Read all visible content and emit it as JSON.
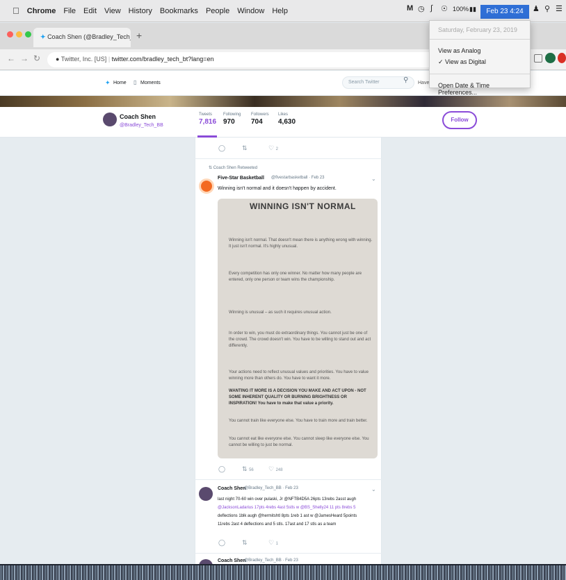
{
  "menubar": {
    "items": [
      "Chrome",
      "File",
      "Edit",
      "View",
      "History",
      "Bookmarks",
      "People",
      "Window",
      "Help"
    ],
    "battery": "100%",
    "clock": "Feb 23  4:24 PM"
  },
  "clock_menu": {
    "date": "Saturday, February 23, 2019",
    "view_analog": "View as Analog",
    "view_digital": "✓ View as Digital",
    "preferences": "Open Date & Time Preferences..."
  },
  "browser": {
    "tab_title": "Coach Shen (@Bradley_Tech_) ×",
    "address_prefix": "Twitter, Inc. [US]",
    "url": "twitter.com/bradley_tech_bt?lang=en"
  },
  "twitter_nav": {
    "home": "Home",
    "moments": "Moments",
    "search_placeholder": "Search Twitter",
    "have_account": "Have"
  },
  "profile": {
    "name": "Coach Shen",
    "handle": "@Bradley_Tech_BB",
    "stats": [
      {
        "label": "Tweets",
        "value": "7,816"
      },
      {
        "label": "Following",
        "value": "970"
      },
      {
        "label": "Followers",
        "value": "704"
      },
      {
        "label": "Likes",
        "value": "4,630"
      }
    ],
    "follow_label": "Follow"
  },
  "tweets": {
    "top_actions": {
      "replies": "",
      "retweets": "",
      "likes": "2"
    },
    "retweet_note": "Coach Shen Retweeted",
    "rt_author": "Five-Star Basketball",
    "rt_handle_date": "@fivestarbasketball · Feb 23",
    "rt_text": "Winning isn't normal and it doesn't happen by accident.",
    "rt_actions": {
      "replies": "",
      "retweets": "56",
      "likes": "248"
    },
    "photo": {
      "title": "WINNING ISN'T NORMAL",
      "p1": "Winning isn't normal. That doesn't mean there is anything wrong with winning. It just isn't normal. It's highly unusual.",
      "p2": "Every competition has only one winner. No matter how many people are entered, only one person or team wins the championship.",
      "p3": "Winning is unusual – as such it requires unusual action.",
      "p4": "In order to win, you must do extraordinary things. You cannot just be one of the crowd. The crowd doesn't win. You have to be willing to stand out and act differently.",
      "p5": "Your actions need to reflect unusual values and priorities. You have to value winning more than others do. You have to want it more.",
      "p6": "WANTING IT MORE IS A DECISION YOU MAKE AND ACT UPON - NOT SOME INHERENT QUALITY OR BURNING BRIGHTNESS OR INSPIRATION! You have to make that value a priority.",
      "p7": "You cannot train like everyone else. You have to train more and train better.",
      "p8": "You cannot eat like everyone else. You cannot sleep like everyone else. You cannot be willing to just be normal."
    },
    "t2_author": "Coach Shen",
    "t2_handle_date": "@Bradley_Tech_BB · Feb 23",
    "t2_line1": "last night 70-60 win over pulaski, Jr @NFTB4D5A 26pts 13rebs 2asst augh",
    "t2_line2": "@JacksonLadarius 17pts 4rebs 4ast 5stls w @BS_Shelly24 11 pts 8rebs 5",
    "t2_line3": "deflections 1blk augh @hermitshtl 8pts 1reb 1 ast w @JamesHeard 5points",
    "t2_line4": "11rebs 2ast 4 deflections and 5 stls. 17ast and 17 stls as a team",
    "t2_actions": {
      "replies": "",
      "retweets": "",
      "likes": "1"
    },
    "t3_author": "Coach Shen",
    "t3_handle_date": "@Bradley_Tech_BB · Feb 23"
  },
  "colors": {
    "twitter_purple": "#8a4bd8",
    "clock_highlight": "#2f6fd6"
  }
}
